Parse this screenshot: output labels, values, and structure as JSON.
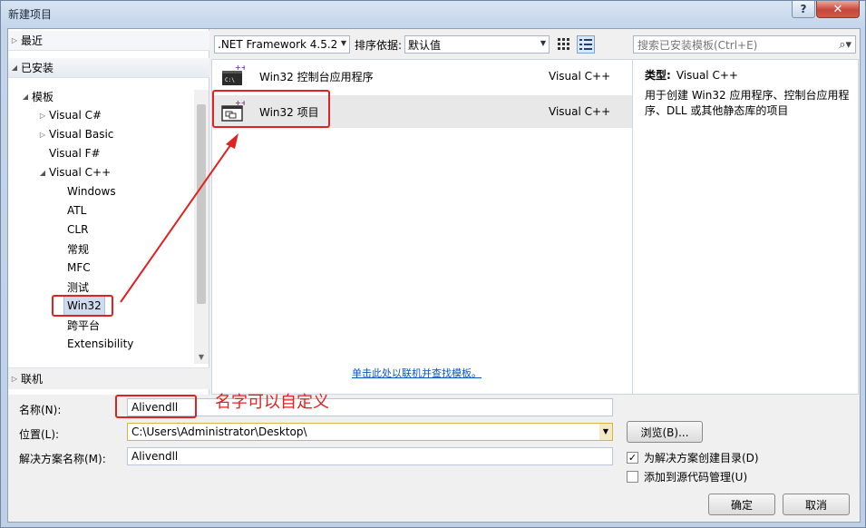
{
  "window": {
    "title": "新建项目",
    "help_label": "?",
    "close_label": "✕"
  },
  "sidebar": {
    "recent": "最近",
    "installed": "已安装",
    "online": "联机",
    "tree": [
      {
        "label": "模板",
        "arrow": "◢"
      },
      {
        "label": "Visual C#",
        "arrow": "▷"
      },
      {
        "label": "Visual Basic",
        "arrow": "▷"
      },
      {
        "label": "Visual F#",
        "arrow": ""
      },
      {
        "label": "Visual C++",
        "arrow": "◢"
      },
      {
        "label": "Windows"
      },
      {
        "label": "ATL"
      },
      {
        "label": "CLR"
      },
      {
        "label": "常规"
      },
      {
        "label": "MFC"
      },
      {
        "label": "测试"
      },
      {
        "label": "Win32"
      },
      {
        "label": "跨平台"
      },
      {
        "label": "Extensibility"
      }
    ]
  },
  "toolbar": {
    "framework": ".NET Framework 4.5.2",
    "sort_label": "排序依据:",
    "sort_value": "默认值",
    "search_placeholder": "搜索已安装模板(Ctrl+E)"
  },
  "templates": [
    {
      "name": "Win32 控制台应用程序",
      "lang": "Visual C++"
    },
    {
      "name": "Win32 项目",
      "lang": "Visual C++"
    }
  ],
  "online_link": "单击此处以联机并查找模板。",
  "description": {
    "type_label": "类型:",
    "type_value": "Visual C++",
    "text": "用于创建 Win32 应用程序、控制台应用程序、DLL 或其他静态库的项目"
  },
  "form": {
    "name_label": "名称(N):",
    "name_value": "Alivendll",
    "location_label": "位置(L):",
    "location_value": "C:\\Users\\Administrator\\Desktop\\",
    "solution_label": "解决方案名称(M):",
    "solution_value": "Alivendll",
    "browse_label": "浏览(B)...",
    "chk_dir_label": "为解决方案创建目录(D)",
    "chk_dir_checked": true,
    "chk_src_label": "添加到源代码管理(U)",
    "chk_src_checked": false,
    "ok_label": "确定",
    "cancel_label": "取消"
  },
  "annotation": {
    "text": "名字可以自定义",
    "color": "#e02222"
  }
}
